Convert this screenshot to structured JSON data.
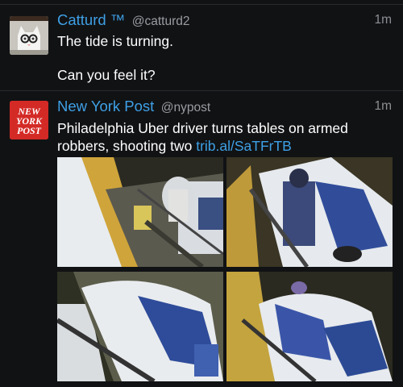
{
  "colors": {
    "background": "#111214",
    "name": "#3ea0e6",
    "link": "#3ea0e6",
    "meta": "#8c8e92"
  },
  "tweets": [
    {
      "name": "Catturd ™",
      "handle": "@catturd2",
      "time": "1m",
      "line1": "The tide is turning.",
      "line2": "Can you feel it?",
      "avatar_icon": "cat-avatar"
    },
    {
      "name": "New York Post",
      "handle": "@nypost",
      "time": "1m",
      "text": "Philadelphia Uber driver turns tables on armed robbers, shooting two",
      "link": "trib.al/SaTFrTB",
      "logo_text": [
        "NEW",
        "YORK",
        "POST"
      ],
      "photo_count": 4
    }
  ]
}
